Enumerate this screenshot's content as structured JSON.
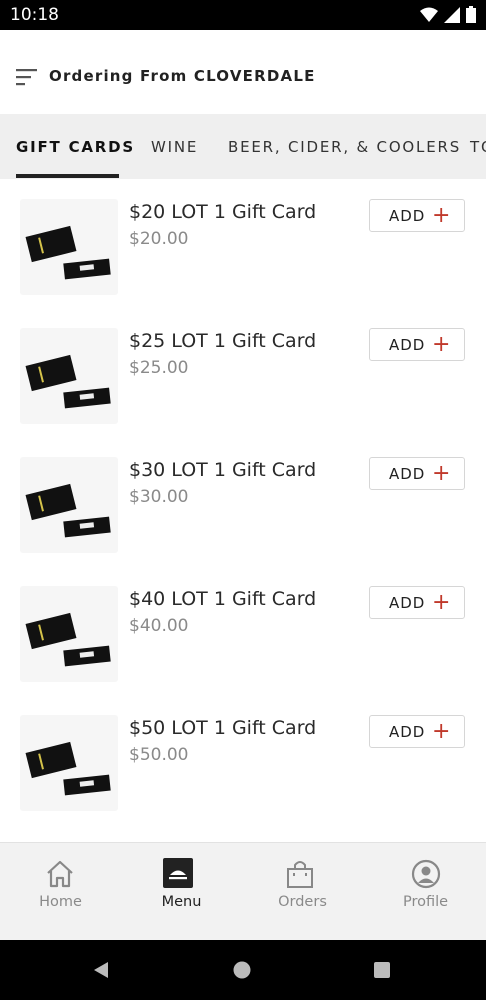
{
  "status_bar": {
    "time": "10:18"
  },
  "header": {
    "title": "Ordering From CLOVERDALE",
    "menu_icon": "menu-lines-icon"
  },
  "tabs": [
    {
      "label": "GIFT CARDS",
      "active": true
    },
    {
      "label": "WINE"
    },
    {
      "label": "BEER, CIDER, & COOLERS"
    },
    {
      "label": "TO"
    }
  ],
  "products": [
    {
      "name": "$20 LOT 1 Gift Card",
      "price": "$20.00",
      "add_label": "ADD",
      "add_icon": "plus-icon"
    },
    {
      "name": "$25 LOT 1 Gift Card",
      "price": "$25.00",
      "add_label": "ADD",
      "add_icon": "plus-icon"
    },
    {
      "name": "$30 LOT 1 Gift Card",
      "price": "$30.00",
      "add_label": "ADD",
      "add_icon": "plus-icon"
    },
    {
      "name": "$40 LOT 1 Gift Card",
      "price": "$40.00",
      "add_label": "ADD",
      "add_icon": "plus-icon"
    },
    {
      "name": "$50 LOT 1 Gift Card",
      "price": "$50.00",
      "add_label": "ADD",
      "add_icon": "plus-icon"
    }
  ],
  "bottom_nav": [
    {
      "label": "Home",
      "icon": "home-icon"
    },
    {
      "label": "Menu",
      "icon": "menu-tray-icon",
      "active": true
    },
    {
      "label": "Orders",
      "icon": "shopping-bag-icon"
    },
    {
      "label": "Profile",
      "icon": "profile-icon"
    }
  ],
  "colors": {
    "accent_plus": "#c0392b",
    "tab_bar_bg": "#efefef",
    "nav_bg": "#f2f2f2"
  }
}
